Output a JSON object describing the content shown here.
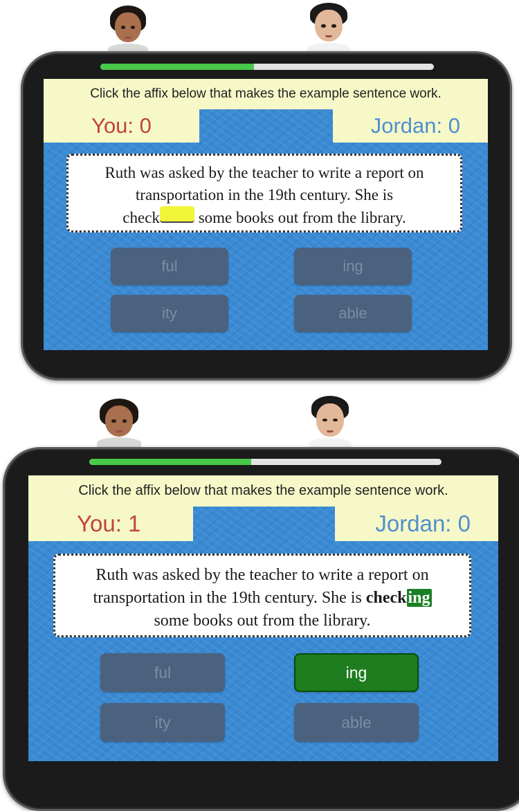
{
  "panels": [
    {
      "instruction": "Click the affix below that makes the example sentence work.",
      "you_score": "You: 0",
      "opponent_score": "Jordan: 0",
      "progress": 0.46,
      "sentence": {
        "line1": "Ruth was asked by the teacher to write a report on",
        "line2": "transportation in the 19th century. She is",
        "line3_before": "check",
        "line3_after": " some books out from the library."
      },
      "choices": [
        "ful",
        "ing",
        "ity",
        "able"
      ]
    },
    {
      "instruction": "Click the affix below that makes the example sentence work.",
      "you_score": "You: 1",
      "opponent_score": "Jordan: 0",
      "progress": 0.46,
      "selected": "ing",
      "sentence": {
        "line1": "Ruth was asked by the teacher to write a report on",
        "line2_before": "transportation in the 19th century. She is ",
        "line2_stem": "check",
        "line2_affix": "ing",
        "line3": "some books out from the library."
      },
      "choices": [
        "ful",
        "ing",
        "ity",
        "able"
      ]
    }
  ],
  "colors": {
    "screen_blue": "#3a8ad4",
    "instruction_bg": "#f6f8c8",
    "you_red": "#c0443d",
    "opponent_blue": "#4e90cf",
    "progress_green": "#48c94a",
    "correct_green": "#1e7d1e",
    "choice_slate": "#4b627e"
  },
  "icons": [
    "student-avatar-icon",
    "opponent-jordan-avatar-icon"
  ]
}
